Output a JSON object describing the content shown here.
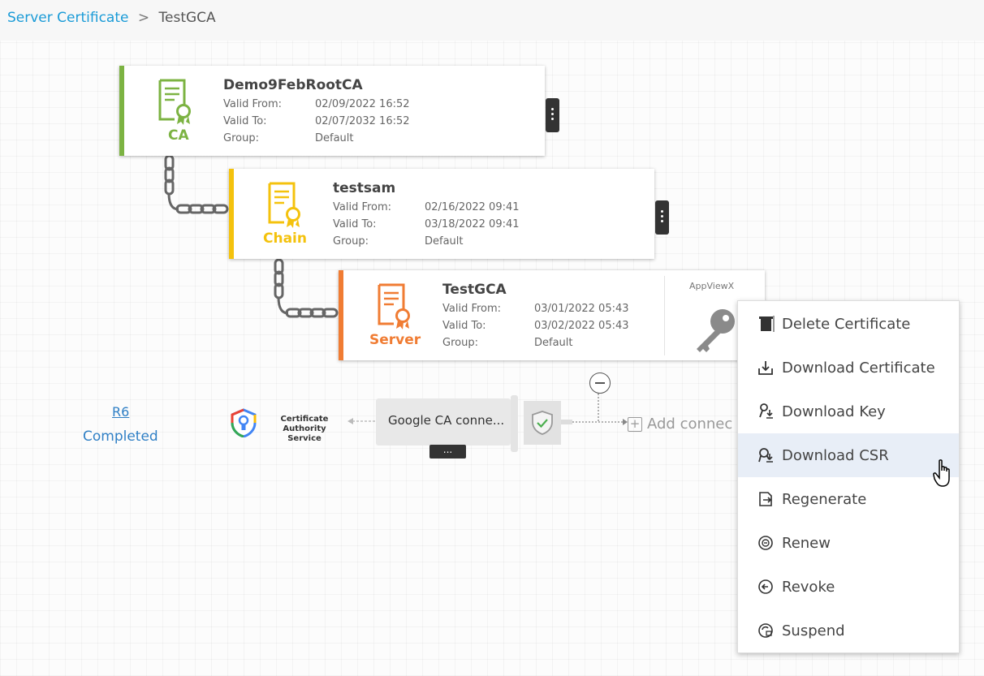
{
  "breadcrumb": {
    "parent": "Server Certificate",
    "separator": ">",
    "current": "TestGCA"
  },
  "certificates": [
    {
      "type_label": "CA",
      "name": "Demo9FebRootCA",
      "valid_from_label": "Valid From:",
      "valid_from": "02/09/2022 16:52",
      "valid_to_label": "Valid To:",
      "valid_to": "02/07/2032 16:52",
      "group_label": "Group:",
      "group": "Default",
      "color": "#7cb342"
    },
    {
      "type_label": "Chain",
      "name": "testsam",
      "valid_from_label": "Valid From:",
      "valid_from": "02/16/2022 09:41",
      "valid_to_label": "Valid To:",
      "valid_to": "03/18/2022 09:41",
      "group_label": "Group:",
      "group": "Default",
      "color": "#f4c20d"
    },
    {
      "type_label": "Server",
      "name": "TestGCA",
      "valid_from_label": "Valid From:",
      "valid_from": "03/01/2022 05:43",
      "valid_to_label": "Valid To:",
      "valid_to": "03/02/2022 05:43",
      "group_label": "Group:",
      "group": "Default",
      "color": "#f07c33",
      "key_label": "AppViewX"
    }
  ],
  "run": {
    "id": "R6",
    "status": "Completed"
  },
  "connector": {
    "ca_service_name": "Certificate Authority Service",
    "ca_service_line1": "Certificate Authority",
    "ca_service_line2": "Service",
    "label": "Google CA conne...",
    "more": "...",
    "add_label": "Add connec"
  },
  "context_menu": {
    "items": [
      {
        "label": "Delete Certificate",
        "icon": "trash-icon"
      },
      {
        "label": "Download Certificate",
        "icon": "download-tray-icon"
      },
      {
        "label": "Download Key",
        "icon": "key-download-icon"
      },
      {
        "label": "Download CSR",
        "icon": "csr-download-icon",
        "highlighted": true
      },
      {
        "label": "Regenerate",
        "icon": "regenerate-icon"
      },
      {
        "label": "Renew",
        "icon": "renew-icon"
      },
      {
        "label": "Revoke",
        "icon": "revoke-icon"
      },
      {
        "label": "Suspend",
        "icon": "suspend-icon"
      }
    ]
  },
  "colors": {
    "link": "#1a9bd7",
    "ca": "#7cb342",
    "chain": "#f4c20d",
    "server": "#f07c33",
    "menu_highlight": "#e8eef7"
  }
}
